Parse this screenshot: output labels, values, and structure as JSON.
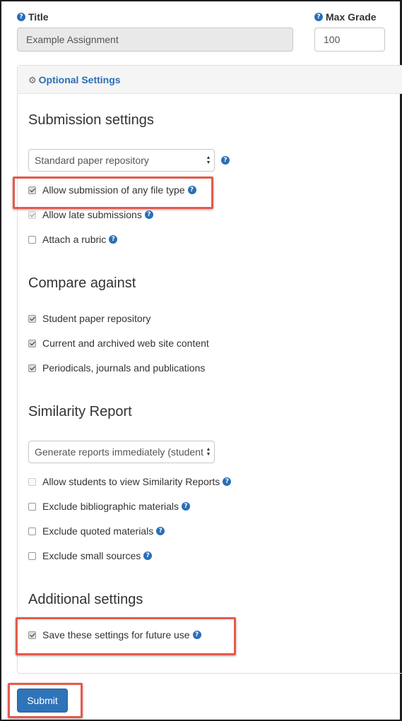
{
  "form": {
    "title_label": "Title",
    "title_value": "Example Assignment",
    "grade_label": "Max Grade",
    "grade_value": "100"
  },
  "optional_settings": {
    "header": "Optional Settings"
  },
  "submission": {
    "heading": "Submission settings",
    "repository_select": "Standard paper repository",
    "options": [
      {
        "label": "Allow submission of any file type",
        "checked": true,
        "disabled": false,
        "help": true
      },
      {
        "label": "Allow late submissions",
        "checked": true,
        "disabled": true,
        "help": true
      },
      {
        "label": "Attach a rubric",
        "checked": false,
        "disabled": false,
        "help": true
      }
    ]
  },
  "compare": {
    "heading": "Compare against",
    "options": [
      {
        "label": "Student paper repository",
        "checked": true
      },
      {
        "label": "Current and archived web site content",
        "checked": true
      },
      {
        "label": "Periodicals, journals and publications",
        "checked": true
      }
    ]
  },
  "similarity": {
    "heading": "Similarity Report",
    "generate_select": "Generate reports immediately (student",
    "options": [
      {
        "label": "Allow students to view Similarity Reports",
        "checked": false,
        "disabled": true,
        "help": true
      },
      {
        "label": "Exclude bibliographic materials",
        "checked": false,
        "disabled": false,
        "help": true
      },
      {
        "label": "Exclude quoted materials",
        "checked": false,
        "disabled": false,
        "help": true
      },
      {
        "label": "Exclude small sources",
        "checked": false,
        "disabled": false,
        "help": true
      }
    ]
  },
  "additional": {
    "heading": "Additional settings",
    "options": [
      {
        "label": "Save these settings for future use",
        "checked": true,
        "disabled": false,
        "help": true
      }
    ]
  },
  "actions": {
    "submit_label": "Submit"
  },
  "icons": {
    "help": "question-circle-icon",
    "gear": "gear-icon"
  },
  "colors": {
    "accent": "#2a6fb6",
    "highlight": "#e55a4c",
    "submit": "#2f73b8"
  }
}
